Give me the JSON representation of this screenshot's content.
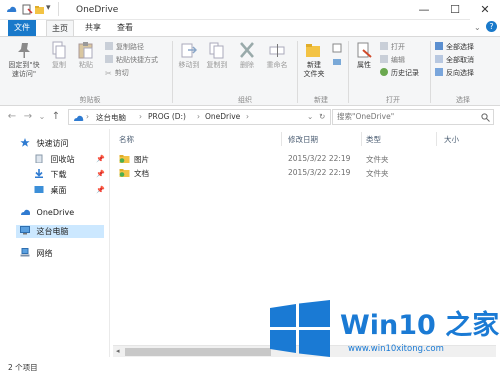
{
  "window": {
    "title": "OneDrive",
    "controls": {
      "minimize": "—",
      "maximize": "☐",
      "close": "✕"
    }
  },
  "ribbon_tabs": [
    {
      "label": "文件"
    },
    {
      "label": "主页"
    },
    {
      "label": "共享"
    },
    {
      "label": "查看"
    }
  ],
  "ribbon": {
    "clipboard": {
      "pin_quick_access": "固定到\"快\n速访问\"",
      "copy": "复制",
      "paste": "粘贴",
      "copy_path": "复制路径",
      "paste_shortcut": "粘贴快捷方式",
      "cut": "剪切",
      "group": "剪贴板"
    },
    "organize": {
      "move_to": "移动到",
      "copy_to": "复制到",
      "delete": "删除",
      "rename": "重命名",
      "group": "组织"
    },
    "new": {
      "new_folder": "新建\n文件夹",
      "group": "新建"
    },
    "open": {
      "properties": "属性",
      "open": "打开",
      "edit": "编辑",
      "history": "历史记录",
      "group": "打开"
    },
    "select": {
      "select_all": "全部选择",
      "select_none": "全部取消",
      "invert": "反向选择",
      "group": "选择"
    }
  },
  "address": {
    "back": "←",
    "forward": "→",
    "recent": "⌄",
    "up": "↑",
    "crumbs": [
      "这台电脑",
      "PROG (D:)",
      "OneDrive"
    ],
    "search_placeholder": "搜索\"OneDrive\""
  },
  "nav": {
    "quick_access": "快速访问",
    "recycle_bin": "回收站",
    "downloads": "下载",
    "desktop": "桌面",
    "onedrive": "OneDrive",
    "this_pc": "这台电脑",
    "network": "网络"
  },
  "columns": {
    "name": "名称",
    "modified": "修改日期",
    "type": "类型",
    "size": "大小"
  },
  "files": [
    {
      "name": "图片",
      "modified": "2015/3/22 22:19",
      "type": "文件夹"
    },
    {
      "name": "文档",
      "modified": "2015/3/22 22:19",
      "type": "文件夹"
    }
  ],
  "status": {
    "item_count": "2 个项目"
  },
  "watermark": {
    "brand": "Win10 之家",
    "url": "www.win10xitong.com"
  },
  "colors": {
    "accent": "#1979ca",
    "logo_blue": "#1a7ad4",
    "folder_yellow": "#f3c344",
    "selection": "#cce8ff"
  }
}
